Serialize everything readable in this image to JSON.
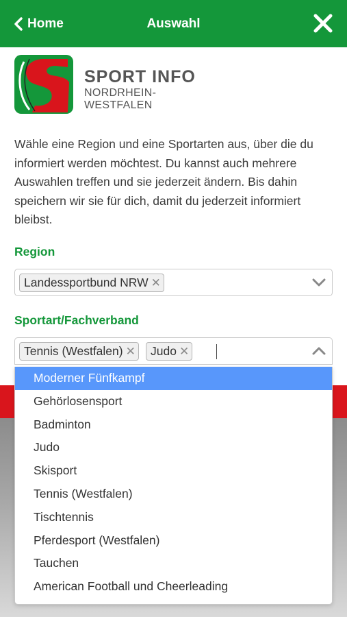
{
  "header": {
    "back_label": "Home",
    "title": "Auswahl",
    "bg_color": "#14973a"
  },
  "logo": {
    "line1": "SPORT INFO",
    "line2": "NORDRHEIN-WESTFALEN"
  },
  "intro": "Wähle eine Region und eine Sportarten aus, über die du informiert werden möchtest. Du kannst auch mehrere Auswahlen treffen und sie jederzeit ändern. Bis dahin speichern wir sie für dich, damit du jederzeit informiert bleibst.",
  "region": {
    "label": "Region",
    "selected": [
      "Landessportbund NRW"
    ]
  },
  "sport": {
    "label": "Sportart/Fachverband",
    "selected": [
      "Tennis (Westfalen)",
      "Judo"
    ],
    "options": [
      "Moderner Fünfkampf",
      "Gehörlosensport",
      "Badminton",
      "Judo",
      "Skisport",
      "Tennis (Westfalen)",
      "Tischtennis",
      "Pferdesport (Westfalen)",
      "Tauchen",
      "American Football und Cheerleading"
    ],
    "highlighted": "Moderner Fünfkampf"
  },
  "colors": {
    "accent": "#14973a",
    "highlight": "#5897fb",
    "banner": "#d9151c"
  }
}
